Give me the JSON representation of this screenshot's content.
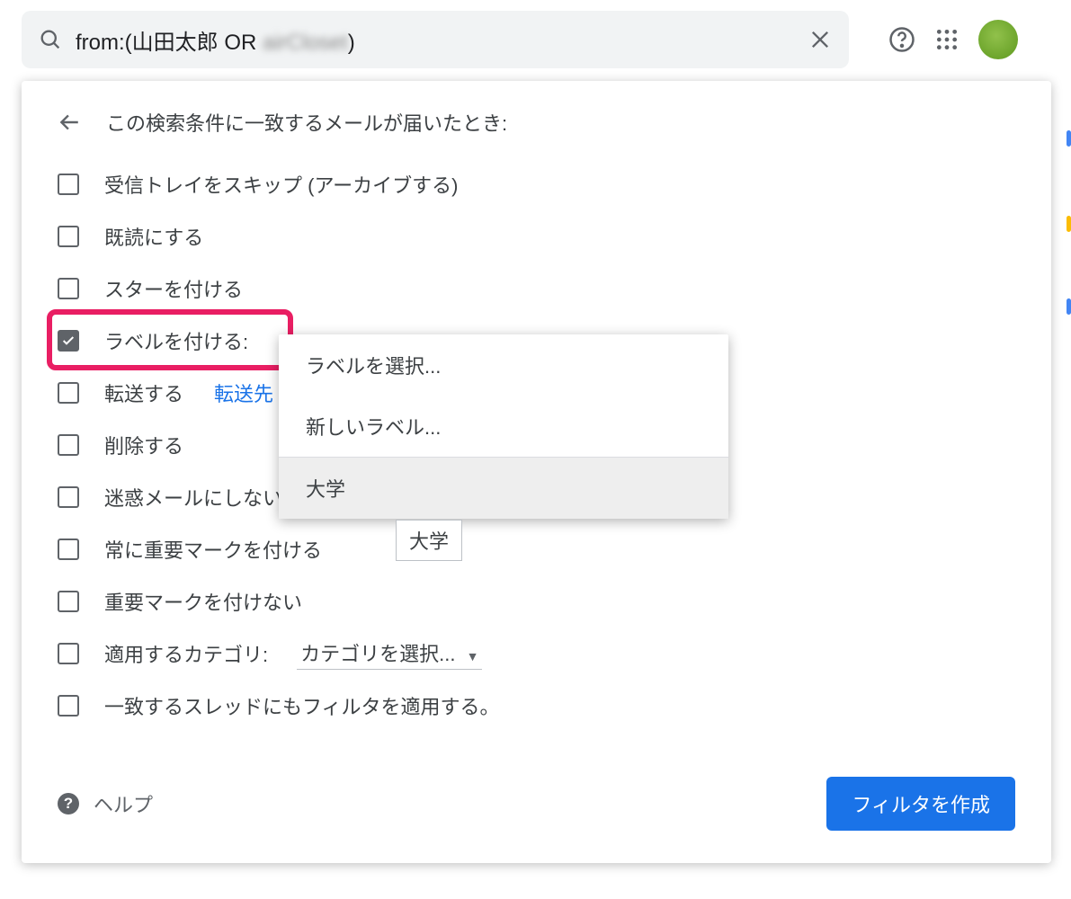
{
  "search": {
    "query_visible": "from:(山田太郎 OR ",
    "query_blurred": "airCloset",
    "query_tail": ")"
  },
  "panel": {
    "title": "この検索条件に一致するメールが届いたとき:",
    "options": {
      "skip_inbox": "受信トレイをスキップ (アーカイブする)",
      "mark_read": "既読にする",
      "star": "スターを付ける",
      "apply_label": "ラベルを付ける:",
      "forward": "転送する",
      "forward_link": "転送先",
      "delete": "削除する",
      "never_spam": "迷惑メールにしない",
      "always_important": "常に重要マークを付ける",
      "never_important": "重要マークを付けない",
      "categorize": "適用するカテゴリ:",
      "category_select": "カテゴリを選択...",
      "also_apply": "一致するスレッドにもフィルタを適用する。"
    },
    "checked": {
      "apply_label": true
    }
  },
  "label_dropdown": {
    "choose_label": "ラベルを選択...",
    "new_label": "新しいラベル...",
    "existing_label": "大学"
  },
  "tooltip": {
    "text": "大学"
  },
  "footer": {
    "help": "ヘルプ",
    "create_filter": "フィルタを作成"
  }
}
